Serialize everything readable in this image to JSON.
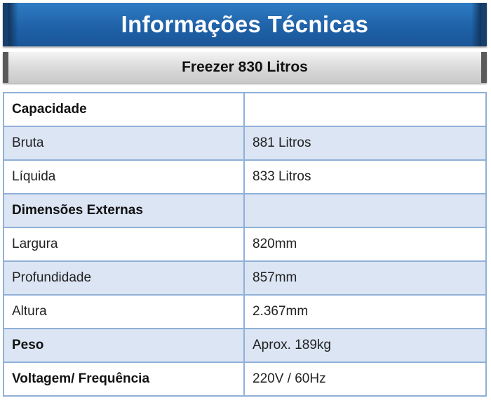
{
  "header": {
    "title": "Informações Técnicas",
    "subtitle": "Freezer 830 Litros"
  },
  "colors": {
    "title_banner": "#1f62a8",
    "subtitle_banner": "#d8d8d8",
    "row_tint": "#dbe5f3",
    "border": "#8fb0d8"
  },
  "specs": [
    {
      "label": "Capacidade",
      "value": "",
      "bold": true
    },
    {
      "label": "Bruta",
      "value": "881 Litros",
      "bold": false
    },
    {
      "label": "Líquida",
      "value": "833 Litros",
      "bold": false
    },
    {
      "label": "Dimensões Externas",
      "value": "",
      "bold": true
    },
    {
      "label": "Largura",
      "value": "820mm",
      "bold": false
    },
    {
      "label": "Profundidade",
      "value": "857mm",
      "bold": false
    },
    {
      "label": "Altura",
      "value": "2.367mm",
      "bold": false
    },
    {
      "label": "Peso",
      "value": "Aprox. 189kg",
      "bold": true
    },
    {
      "label": "Voltagem/ Frequência",
      "value": "220V / 60Hz",
      "bold": true
    }
  ]
}
